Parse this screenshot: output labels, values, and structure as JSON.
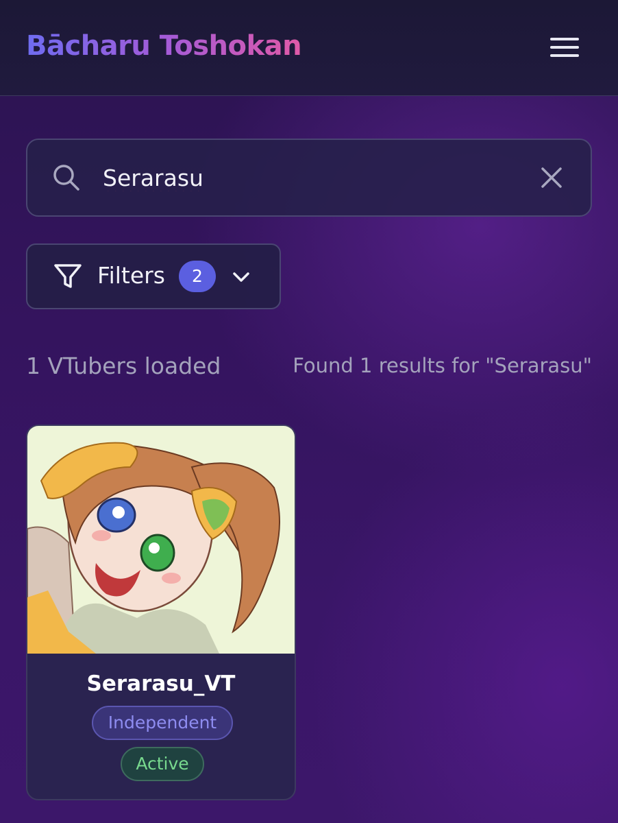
{
  "header": {
    "brand": "Bācharu Toshokan",
    "menu_icon": "hamburger-menu-icon"
  },
  "search": {
    "value": "Serarasu",
    "placeholder": "",
    "icon": "search-icon",
    "clear_icon": "close-icon"
  },
  "filters": {
    "label": "Filters",
    "count": "2",
    "icon": "funnel-icon",
    "chevron": "chevron-down-icon"
  },
  "stats": {
    "loaded": "1 VTubers loaded",
    "found": "Found 1 results for \"Serarasu\""
  },
  "results": [
    {
      "name": "Serarasu_VT",
      "affiliation": "Independent",
      "status": "Active"
    }
  ],
  "colors": {
    "accent": "#5b5fe0",
    "brand_gradient_start": "#6f6cf0",
    "brand_gradient_end": "#e05aa8",
    "independent_tag": "#8e8cf0",
    "active_tag": "#78d98e"
  }
}
